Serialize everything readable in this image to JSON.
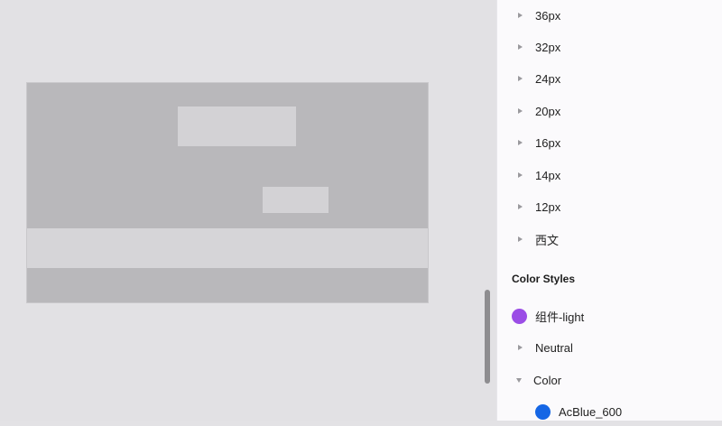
{
  "panel": {
    "text_styles": [
      "36px",
      "32px",
      "24px",
      "20px",
      "16px",
      "14px",
      "12px",
      "西文"
    ],
    "color_section_title": "Color Styles",
    "color_style": {
      "label": "组件-light",
      "color": "#9b4de6"
    },
    "groups": [
      {
        "label": "Neutral",
        "expanded": false
      },
      {
        "label": "Color",
        "expanded": true
      }
    ],
    "sub_color": {
      "label": "AcBlue_600",
      "color": "#1566e5"
    }
  },
  "canvas_scroll": {
    "position": 0.83
  }
}
